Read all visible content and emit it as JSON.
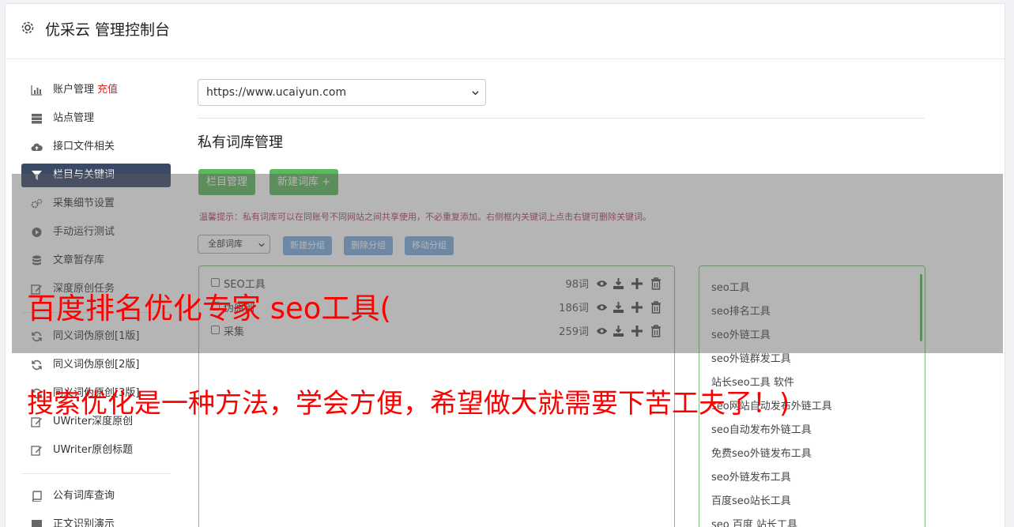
{
  "header": {
    "title": "优采云 管理控制台"
  },
  "sidebar": {
    "items": [
      {
        "label": "账户管理",
        "badge": "充值",
        "icon": "bar-chart-icon"
      },
      {
        "label": "站点管理",
        "icon": "server-icon"
      },
      {
        "label": "接口文件相关",
        "icon": "cloud-upload-icon"
      },
      {
        "label": "栏目与关键词",
        "icon": "filter-icon",
        "active": true
      },
      {
        "label": "采集细节设置",
        "icon": "gears-icon"
      },
      {
        "label": "手动运行测试",
        "icon": "play-circle-icon"
      },
      {
        "label": "文章暂存库",
        "icon": "database-icon"
      },
      {
        "label": "深度原创任务",
        "icon": "edit-icon"
      },
      {
        "label": "同义词伪原创[1版]",
        "icon": "refresh-icon"
      },
      {
        "label": "同义词伪原创[2版]",
        "icon": "refresh-icon"
      },
      {
        "label": "同义词伪原创[3版]",
        "icon": "refresh-icon"
      },
      {
        "label": "UWriter深度原创",
        "icon": "edit-icon"
      },
      {
        "label": "UWriter原创标题",
        "icon": "edit-icon"
      },
      {
        "label": "公有词库查询",
        "icon": "book-icon"
      },
      {
        "label": "正文识别演示",
        "icon": "monitor-icon"
      }
    ]
  },
  "main": {
    "site_select": "https://www.ucaiyun.com",
    "title": "私有词库管理",
    "btn_column": "栏目管理",
    "btn_new_lib": "新建词库 +",
    "tip": "温馨提示：私有词库可以在同账号不同网站之间共享使用，不必重复添加。右侧框内关键词上点击右键可删除关键词。",
    "filter_select": "全部词库",
    "btn_new_group": "新建分组",
    "btn_delete_group": "删除分组",
    "btn_move_group": "移动分组",
    "libraries": [
      {
        "name": "SEO工具",
        "count": "98词"
      },
      {
        "name": "伪原创",
        "count": "186词"
      },
      {
        "name": "采集",
        "count": "259词"
      }
    ],
    "keywords": [
      "seo工具",
      "seo排名工具",
      "seo外链工具",
      "seo外链群发工具",
      "站长seo工具 软件",
      "seo网站自动发布外链工具",
      "seo自动发布外链工具",
      "免费seo外链发布工具",
      "seo外链发布工具",
      "百度seo站长工具",
      "seo 百度 站长工具"
    ]
  },
  "overlay": {
    "line1": "百度排名优化专家 seo工具(",
    "line2": "搜索优化是一种方法，学会方便，希望做大就需要下苦工夫了！)"
  },
  "colors": {
    "active_nav": "#3a4a66",
    "green": "#5cb85c",
    "blue": "#7aaee0",
    "overlay_text": "#ff0000",
    "badge": "#e02020"
  }
}
